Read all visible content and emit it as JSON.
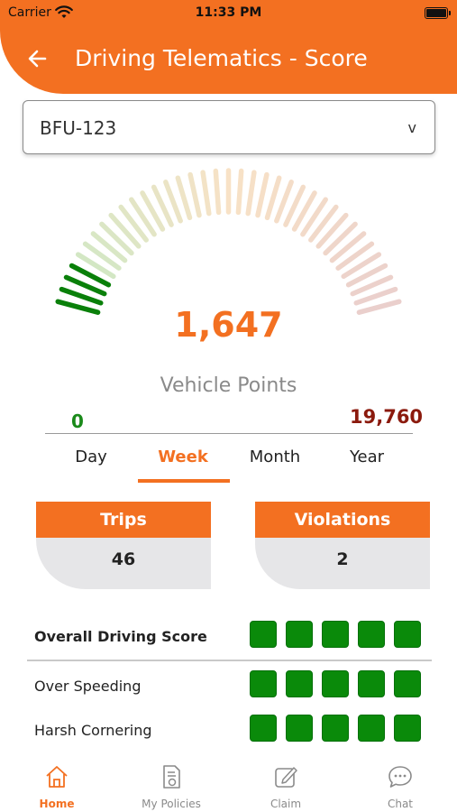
{
  "status_bar": {
    "carrier": "Carrier",
    "time": "11:33 PM"
  },
  "header": {
    "title": "Driving Telematics - Score"
  },
  "vehicle_select": {
    "selected": "BFU-123",
    "chevron": "v"
  },
  "gauge": {
    "value_text": "1,647",
    "label": "Vehicle Points",
    "min_label": "0",
    "max_label": "19,760",
    "value": 1647,
    "min": 0,
    "max": 19760,
    "colors": {
      "active": "#0a800a",
      "low": "#c9e9c4",
      "mid": "#f8e2c6",
      "high": "#eacfcc",
      "value_text": "#f37021"
    }
  },
  "tabs": [
    {
      "label": "Day",
      "active": false
    },
    {
      "label": "Week",
      "active": true
    },
    {
      "label": "Month",
      "active": false
    },
    {
      "label": "Year",
      "active": false
    }
  ],
  "stats": {
    "trips": {
      "label": "Trips",
      "value": "46"
    },
    "violations": {
      "label": "Violations",
      "value": "2"
    }
  },
  "scores": [
    {
      "label": "Overall Driving Score",
      "bold": true,
      "filled": 5,
      "total": 5
    },
    {
      "label": "Over Speeding",
      "bold": false,
      "filled": 5,
      "total": 5
    },
    {
      "label": "Harsh Cornering",
      "bold": false,
      "filled": 5,
      "total": 5
    }
  ],
  "bottom_nav": [
    {
      "label": "Home",
      "icon": "home-icon",
      "active": true
    },
    {
      "label": "My Policies",
      "icon": "policy-document-icon",
      "active": false
    },
    {
      "label": "Claim",
      "icon": "edit-claim-icon",
      "active": false
    },
    {
      "label": "Chat",
      "icon": "chat-bubble-icon",
      "active": false
    }
  ],
  "colors": {
    "accent": "#f37021",
    "score_green": "#0a8a0a",
    "card_body": "#e6e6e8"
  }
}
